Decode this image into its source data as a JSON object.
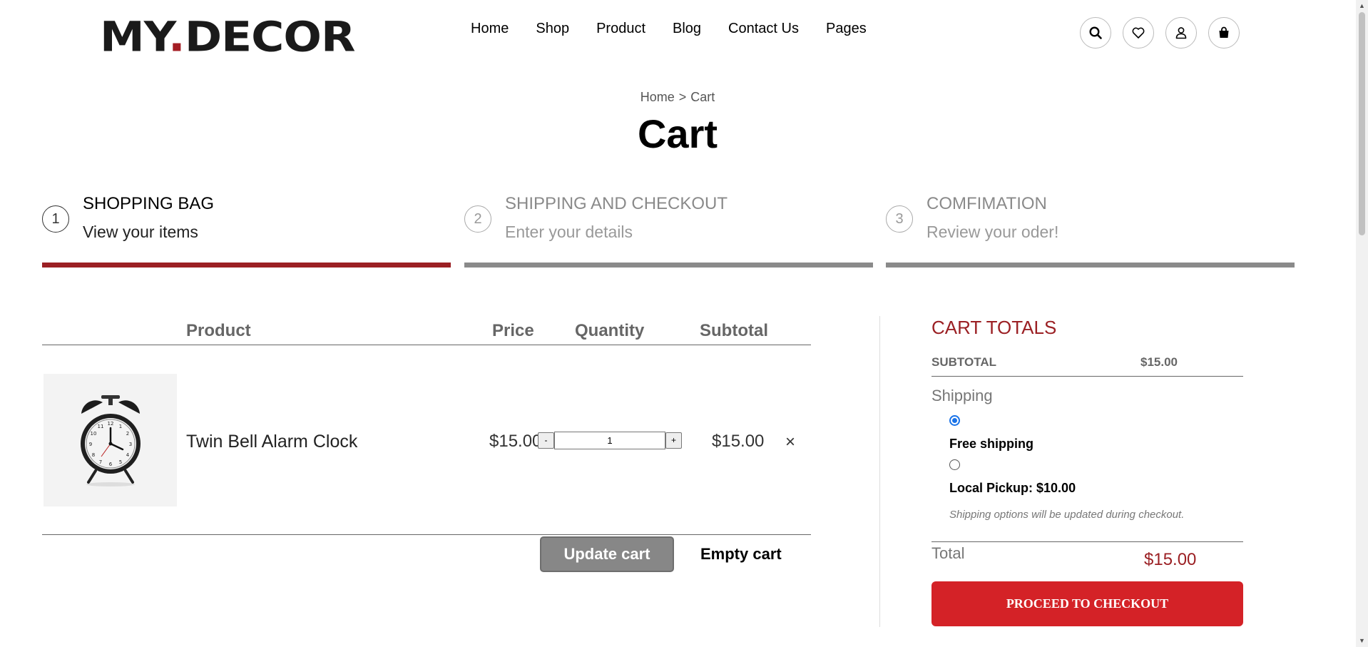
{
  "header": {
    "logo_left": "MY",
    "logo_dot": ".",
    "logo_right": "DECOR",
    "nav": [
      "Home",
      "Shop",
      "Product",
      "Blog",
      "Contact Us",
      "Pages"
    ],
    "icons": [
      "search-icon",
      "heart-icon",
      "user-icon",
      "bag-icon"
    ]
  },
  "breadcrumb": {
    "home": "Home",
    "separator": ">",
    "current": "Cart"
  },
  "page_title": "Cart",
  "steps": [
    {
      "number": "1",
      "title": "SHOPPING BAG",
      "subtitle": "View your items",
      "active": true
    },
    {
      "number": "2",
      "title": "SHIPPING AND CHECKOUT",
      "subtitle": "Enter your details",
      "active": false
    },
    {
      "number": "3",
      "title": "COMFIMATION",
      "subtitle": "Review your oder!",
      "active": false
    }
  ],
  "cart_table": {
    "headers": {
      "product": "Product",
      "price": "Price",
      "quantity": "Quantity",
      "subtotal": "Subtotal"
    },
    "items": [
      {
        "name": "Twin Bell Alarm Clock",
        "price": "$15.00",
        "quantity": "1",
        "subtotal": "$15.00",
        "remove": "×",
        "decrement": "-",
        "increment": "+"
      }
    ],
    "update_label": "Update cart",
    "empty_label": "Empty cart"
  },
  "totals": {
    "title": "CART TOTALS",
    "subtotal_label": "SUBTOTAL",
    "subtotal_value": "$15.00",
    "shipping_label": "Shipping",
    "options": [
      {
        "label": "Free shipping",
        "selected": true
      },
      {
        "label": "Local Pickup: $10.00",
        "selected": false
      }
    ],
    "note": "Shipping options will be updated during checkout.",
    "total_label": "Total",
    "total_value": "$15.00",
    "checkout_label": "PROCEED TO CHECKOUT"
  },
  "colors": {
    "brand_red": "#9b2024",
    "checkout_red": "#d42227",
    "inactive_gray": "#8a8a8a"
  }
}
